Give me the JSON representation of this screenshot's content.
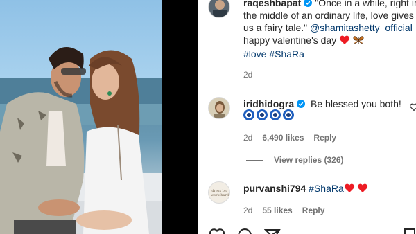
{
  "post": {
    "author": "raqeshbapat",
    "caption_line1": "\"Once in a while, right in",
    "caption_line2": "the middle of an ordinary life, love gives",
    "caption_line3_text": "us a fairy tale.\" ",
    "caption_mention": "@shamitashetty_official",
    "caption_line4": "happy valentine's day",
    "caption_hashtags": "#love #ShaRa",
    "time": "2d"
  },
  "comments": [
    {
      "username": "iridhidogra",
      "verified": true,
      "text": "Be blessed you both!",
      "emoji": "evil-eye x4",
      "time": "2d",
      "likes": "6,490 likes",
      "reply_label": "Reply",
      "view_replies": "View replies (326)"
    },
    {
      "username": "purvanshi794",
      "verified": false,
      "hashtag": "#ShaRa",
      "emoji": "red-heart x2",
      "time": "2d",
      "likes": "55 likes",
      "reply_label": "Reply",
      "avatar_text": "dress big work hard"
    }
  ],
  "colors": {
    "text": "#262626",
    "secondary": "#737373",
    "link": "#00376b",
    "verified": "#0095f6",
    "heart": "#ed1c24"
  },
  "icons": [
    "like-icon",
    "comment-icon",
    "share-icon",
    "save-icon",
    "verified-badge-icon"
  ]
}
